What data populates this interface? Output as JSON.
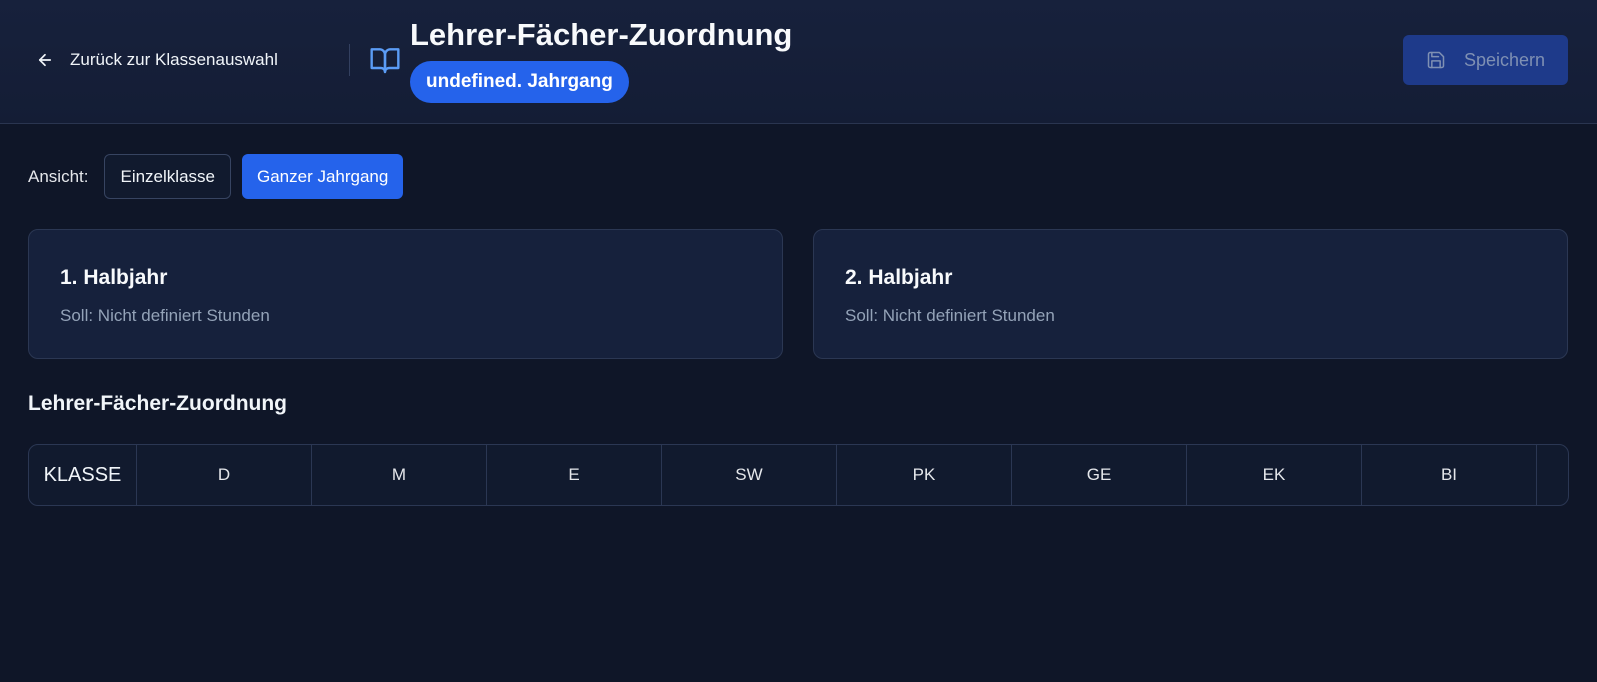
{
  "header": {
    "back_label": "Zurück zur Klassenauswahl",
    "title": "Lehrer-Fächer-Zuordnung",
    "badge": "undefined. Jahrgang",
    "save_label": "Speichern",
    "icons": [
      "arrow-left-icon",
      "book-open-icon",
      "save-icon"
    ]
  },
  "view": {
    "label": "Ansicht:",
    "options": [
      "Einzelklasse",
      "Ganzer Jahrgang"
    ],
    "selected": "Ganzer Jahrgang"
  },
  "halbjahre": [
    {
      "title": "1. Halbjahr",
      "subtitle": "Soll: Nicht definiert Stunden"
    },
    {
      "title": "2. Halbjahr",
      "subtitle": "Soll: Nicht definiert Stunden"
    }
  ],
  "assignment": {
    "title": "Lehrer-Fächer-Zuordnung",
    "columns": [
      "KLASSE",
      "D",
      "M",
      "E",
      "SW",
      "PK",
      "GE",
      "EK",
      "BI"
    ]
  },
  "colors": {
    "accent": "#2563eb",
    "background": "#0f1628",
    "card": "#16213c",
    "muted_text": "#94a3b8"
  }
}
